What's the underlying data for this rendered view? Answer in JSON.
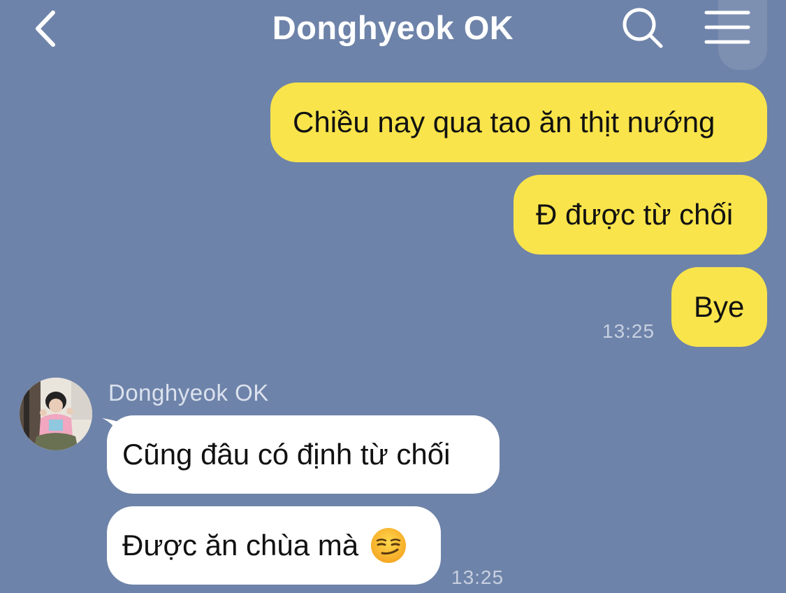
{
  "header": {
    "title": "Donghyeok OK",
    "back_icon": "chevron-left-icon",
    "search_icon": "search-icon",
    "menu_icon": "hamburger-menu-icon"
  },
  "colors": {
    "background": "#6e83a9",
    "outgoing_bubble": "#f9e44b",
    "incoming_bubble": "#ffffff",
    "timestamp": "#c7d0e0"
  },
  "outgoing": {
    "messages": [
      {
        "text": "Chiều nay qua tao ăn thịt nướng"
      },
      {
        "text": "Đ được từ chối"
      },
      {
        "text": "Bye"
      }
    ],
    "time": "13:25"
  },
  "incoming": {
    "sender": "Donghyeok OK",
    "avatar": "profile-photo",
    "messages": [
      {
        "text": "Cũng đâu có định từ chối"
      },
      {
        "text": "Được ăn chùa mà",
        "emoji": "smirking-face-emoji"
      }
    ],
    "time": "13:25"
  }
}
